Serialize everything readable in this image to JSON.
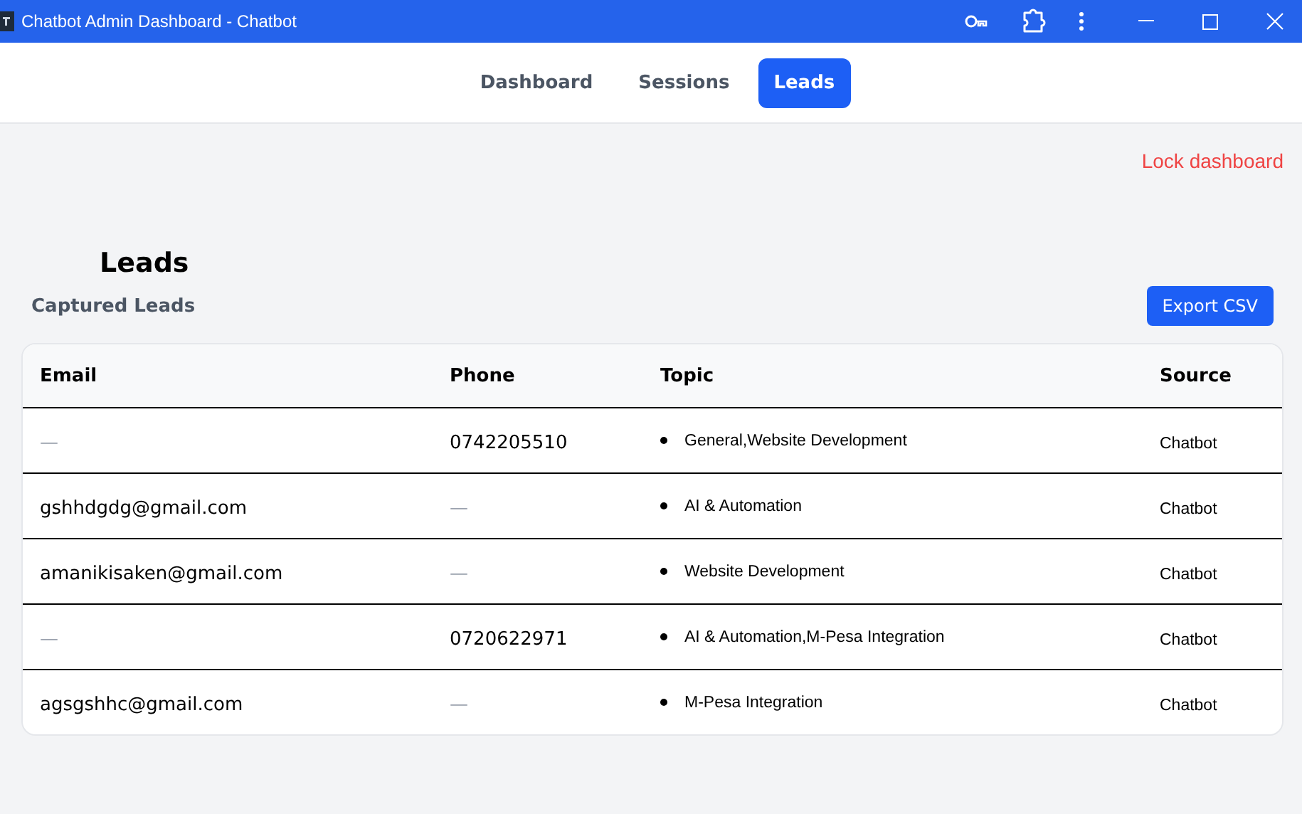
{
  "window": {
    "title": "Chatbot Admin Dashboard - Chatbot"
  },
  "tabs": [
    {
      "label": "Dashboard",
      "selected": false
    },
    {
      "label": "Sessions",
      "selected": false
    },
    {
      "label": "Leads",
      "selected": true
    }
  ],
  "lock_link": "Lock dashboard",
  "heading": "Leads",
  "section": {
    "title": "Captured Leads",
    "export_button": "Export CSV"
  },
  "table": {
    "columns": [
      "Email",
      "Phone",
      "Topic",
      "Source"
    ],
    "rows": [
      {
        "email": {
          "text": "—",
          "empty": true
        },
        "phone": {
          "text": "0742205510",
          "empty": false
        },
        "topics": [
          "General,Website Development"
        ],
        "source": "Chatbot"
      },
      {
        "email": {
          "text": "gshhdgdg@gmail.com",
          "empty": false
        },
        "phone": {
          "text": "—",
          "empty": true
        },
        "topics": [
          "AI & Automation"
        ],
        "source": "Chatbot"
      },
      {
        "email": {
          "text": "amanikisaken@gmail.com",
          "empty": false
        },
        "phone": {
          "text": "—",
          "empty": true
        },
        "topics": [
          "Website Development"
        ],
        "source": "Chatbot"
      },
      {
        "email": {
          "text": "—",
          "empty": true
        },
        "phone": {
          "text": "0720622971",
          "empty": false
        },
        "topics": [
          "AI & Automation,M-Pesa Integration"
        ],
        "source": "Chatbot"
      },
      {
        "email": {
          "text": "agsgshhc@gmail.com",
          "empty": false
        },
        "phone": {
          "text": "—",
          "empty": true
        },
        "topics": [
          "M-Pesa Integration"
        ],
        "source": "Chatbot"
      }
    ]
  }
}
